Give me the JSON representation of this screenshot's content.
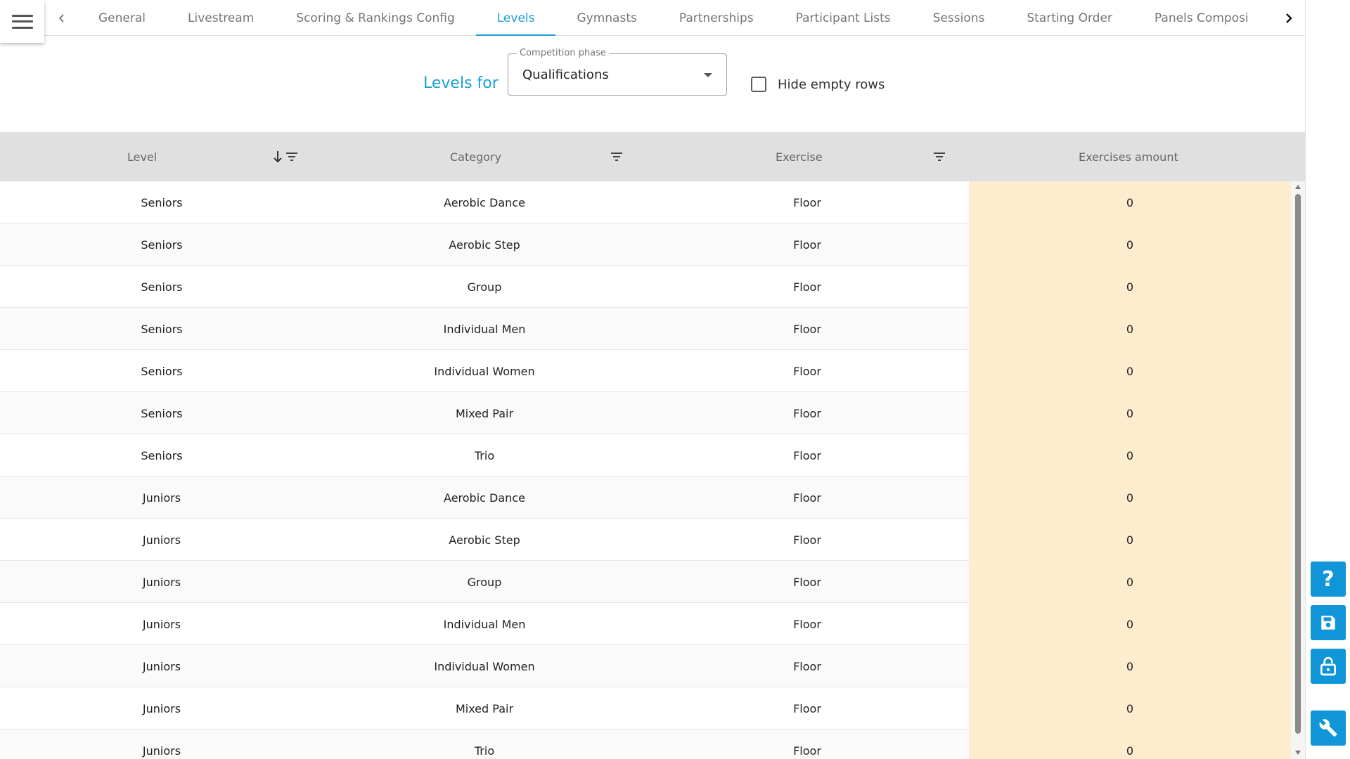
{
  "tabs": [
    {
      "label": "General",
      "active": false
    },
    {
      "label": "Livestream",
      "active": false
    },
    {
      "label": "Scoring & Rankings Config",
      "active": false
    },
    {
      "label": "Levels",
      "active": true
    },
    {
      "label": "Gymnasts",
      "active": false
    },
    {
      "label": "Partnerships",
      "active": false
    },
    {
      "label": "Participant Lists",
      "active": false
    },
    {
      "label": "Sessions",
      "active": false
    },
    {
      "label": "Starting Order",
      "active": false
    },
    {
      "label": "Panels Composi",
      "active": false
    }
  ],
  "filters": {
    "levels_for_label": "Levels for",
    "phase_label": "Competition phase",
    "phase_value": "Qualifications",
    "hide_empty_label": "Hide empty rows",
    "hide_empty_checked": false
  },
  "table": {
    "headers": {
      "level": "Level",
      "category": "Category",
      "exercise": "Exercise",
      "amount": "Exercises amount"
    },
    "rows": [
      {
        "level": "Seniors",
        "category": "Aerobic Dance",
        "exercise": "Floor",
        "amount": "0"
      },
      {
        "level": "Seniors",
        "category": "Aerobic Step",
        "exercise": "Floor",
        "amount": "0"
      },
      {
        "level": "Seniors",
        "category": "Group",
        "exercise": "Floor",
        "amount": "0"
      },
      {
        "level": "Seniors",
        "category": "Individual Men",
        "exercise": "Floor",
        "amount": "0"
      },
      {
        "level": "Seniors",
        "category": "Individual Women",
        "exercise": "Floor",
        "amount": "0"
      },
      {
        "level": "Seniors",
        "category": "Mixed Pair",
        "exercise": "Floor",
        "amount": "0"
      },
      {
        "level": "Seniors",
        "category": "Trio",
        "exercise": "Floor",
        "amount": "0"
      },
      {
        "level": "Juniors",
        "category": "Aerobic Dance",
        "exercise": "Floor",
        "amount": "0"
      },
      {
        "level": "Juniors",
        "category": "Aerobic Step",
        "exercise": "Floor",
        "amount": "0"
      },
      {
        "level": "Juniors",
        "category": "Group",
        "exercise": "Floor",
        "amount": "0"
      },
      {
        "level": "Juniors",
        "category": "Individual Men",
        "exercise": "Floor",
        "amount": "0"
      },
      {
        "level": "Juniors",
        "category": "Individual Women",
        "exercise": "Floor",
        "amount": "0"
      },
      {
        "level": "Juniors",
        "category": "Mixed Pair",
        "exercise": "Floor",
        "amount": "0"
      },
      {
        "level": "Juniors",
        "category": "Trio",
        "exercise": "Floor",
        "amount": "0"
      }
    ]
  },
  "side_actions": [
    {
      "name": "help-button",
      "icon": "help-icon",
      "glyph": "?"
    },
    {
      "name": "save-button",
      "icon": "save-icon"
    },
    {
      "name": "lock-button",
      "icon": "lock-open-icon"
    },
    {
      "name": "tools-button",
      "icon": "wrench-icon"
    }
  ],
  "colors": {
    "accent": "#1a9fd8",
    "fab": "#0f95d8",
    "header_bg": "#e0e0e0",
    "amount_bg": "#fdecce"
  }
}
